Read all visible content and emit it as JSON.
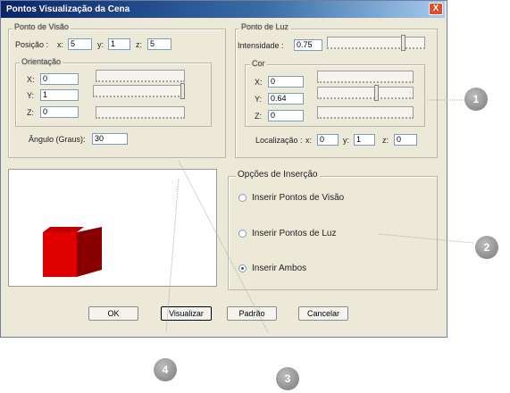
{
  "window": {
    "title": "Pontos Visualização da Cena",
    "close_glyph": "X"
  },
  "view_point": {
    "legend": "Ponto de Visão",
    "position_label": "Posição :",
    "x_label": "x:",
    "x": "5",
    "y_label": "y:",
    "y": "1",
    "z_label": "z:",
    "z": "5",
    "orientation": {
      "legend": "Orientação",
      "x_label": "X:",
      "x": "0",
      "y_label": "Y:",
      "y": "1",
      "z_label": "Z:",
      "z": "0"
    },
    "angle_label": "Ângulo (Graus):",
    "angle": "30"
  },
  "light_point": {
    "legend": "Ponto de Luz",
    "intensity_label": "Intensidade :",
    "intensity": "0.75",
    "color": {
      "legend": "Cor",
      "x_label": "X:",
      "x": "0",
      "y_label": "Y:",
      "y": "0.64",
      "z_label": "Z:",
      "z": "0"
    },
    "location_label": "Localização :",
    "loc_x_label": "x:",
    "loc_x": "0",
    "loc_y_label": "y:",
    "loc_y": "1",
    "loc_z_label": "z:",
    "loc_z": "0"
  },
  "insert_options": {
    "legend": "Opções de Inserção",
    "options": [
      {
        "label": "Inserir Pontos de Visão",
        "checked": false
      },
      {
        "label": "Inserir Pontos de Luz",
        "checked": false
      },
      {
        "label": "Inserir Ambos",
        "checked": true
      }
    ]
  },
  "buttons": {
    "ok": "OK",
    "visualize": "Visualizar",
    "default": "Padrão",
    "cancel": "Cancelar"
  },
  "callouts": [
    "1",
    "2",
    "3",
    "4"
  ],
  "colors": {
    "cube_front": "#e00000",
    "cube_side": "#8a0000",
    "cube_top": "#c00000"
  }
}
